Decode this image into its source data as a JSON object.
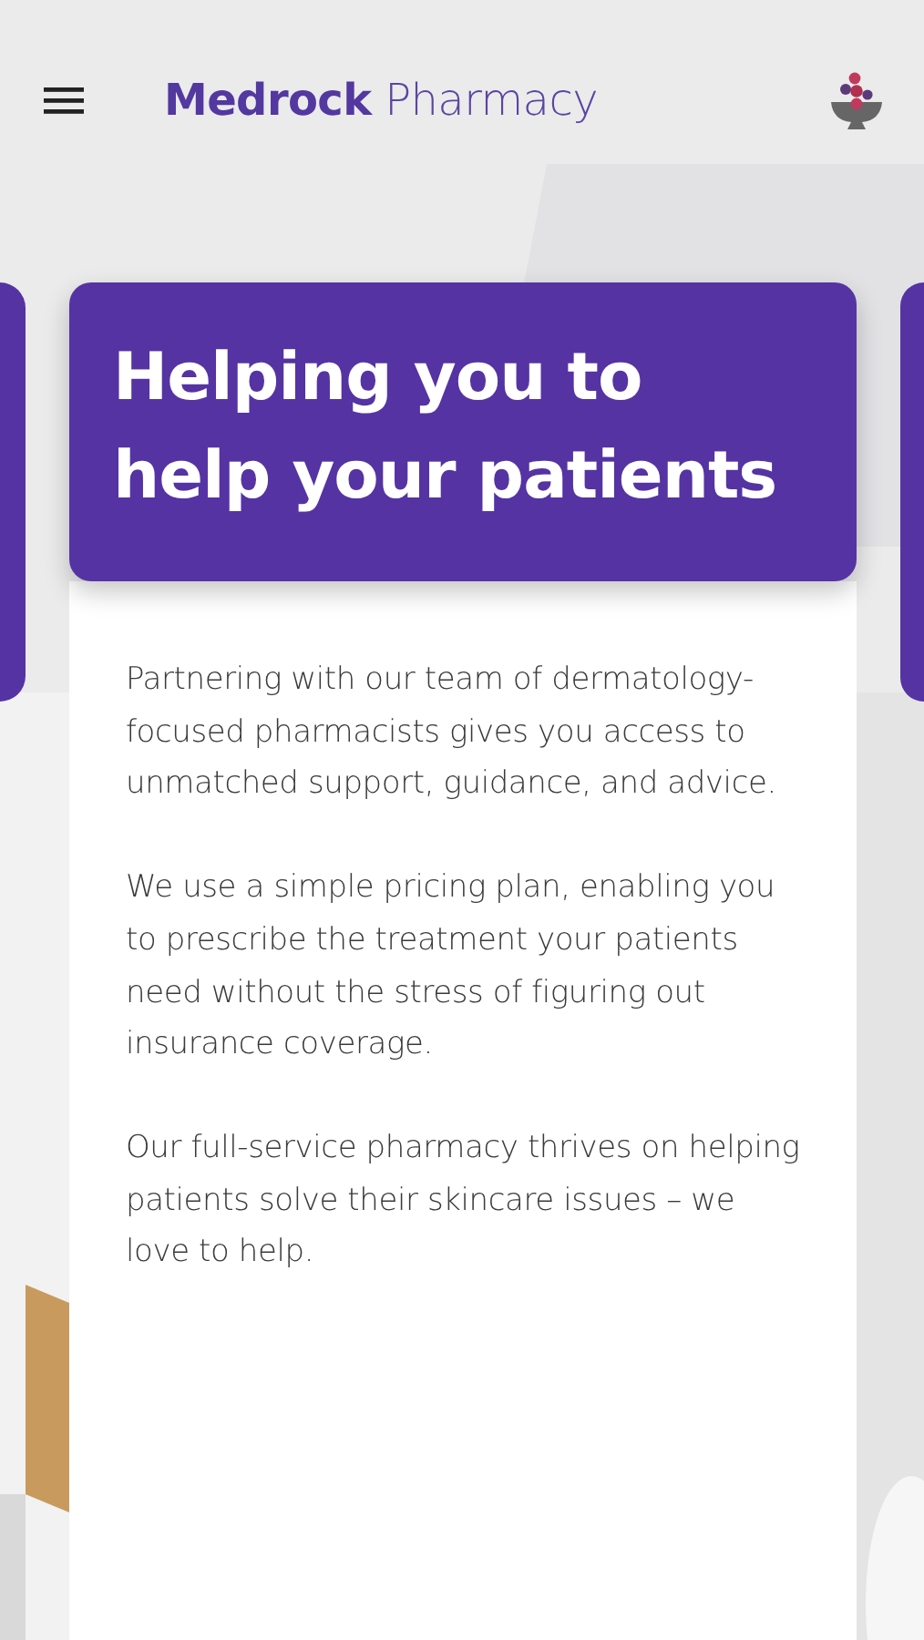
{
  "header": {
    "brand": "**Medrock** Pharmacy"
  },
  "card": {
    "title": "Helping you to help your patients",
    "paragraphs": [
      "Partnering with our team of dermatology-focused pharmacists gives you access to unmatched support, guidance, and advice.",
      "We use a simple pricing plan, enabling you to prescribe the treatment your patients need without the stress of figuring out insurance coverage.",
      "Our full-service pharmacy thrives on helping patients solve their skincare issues – we love to help."
    ]
  }
}
